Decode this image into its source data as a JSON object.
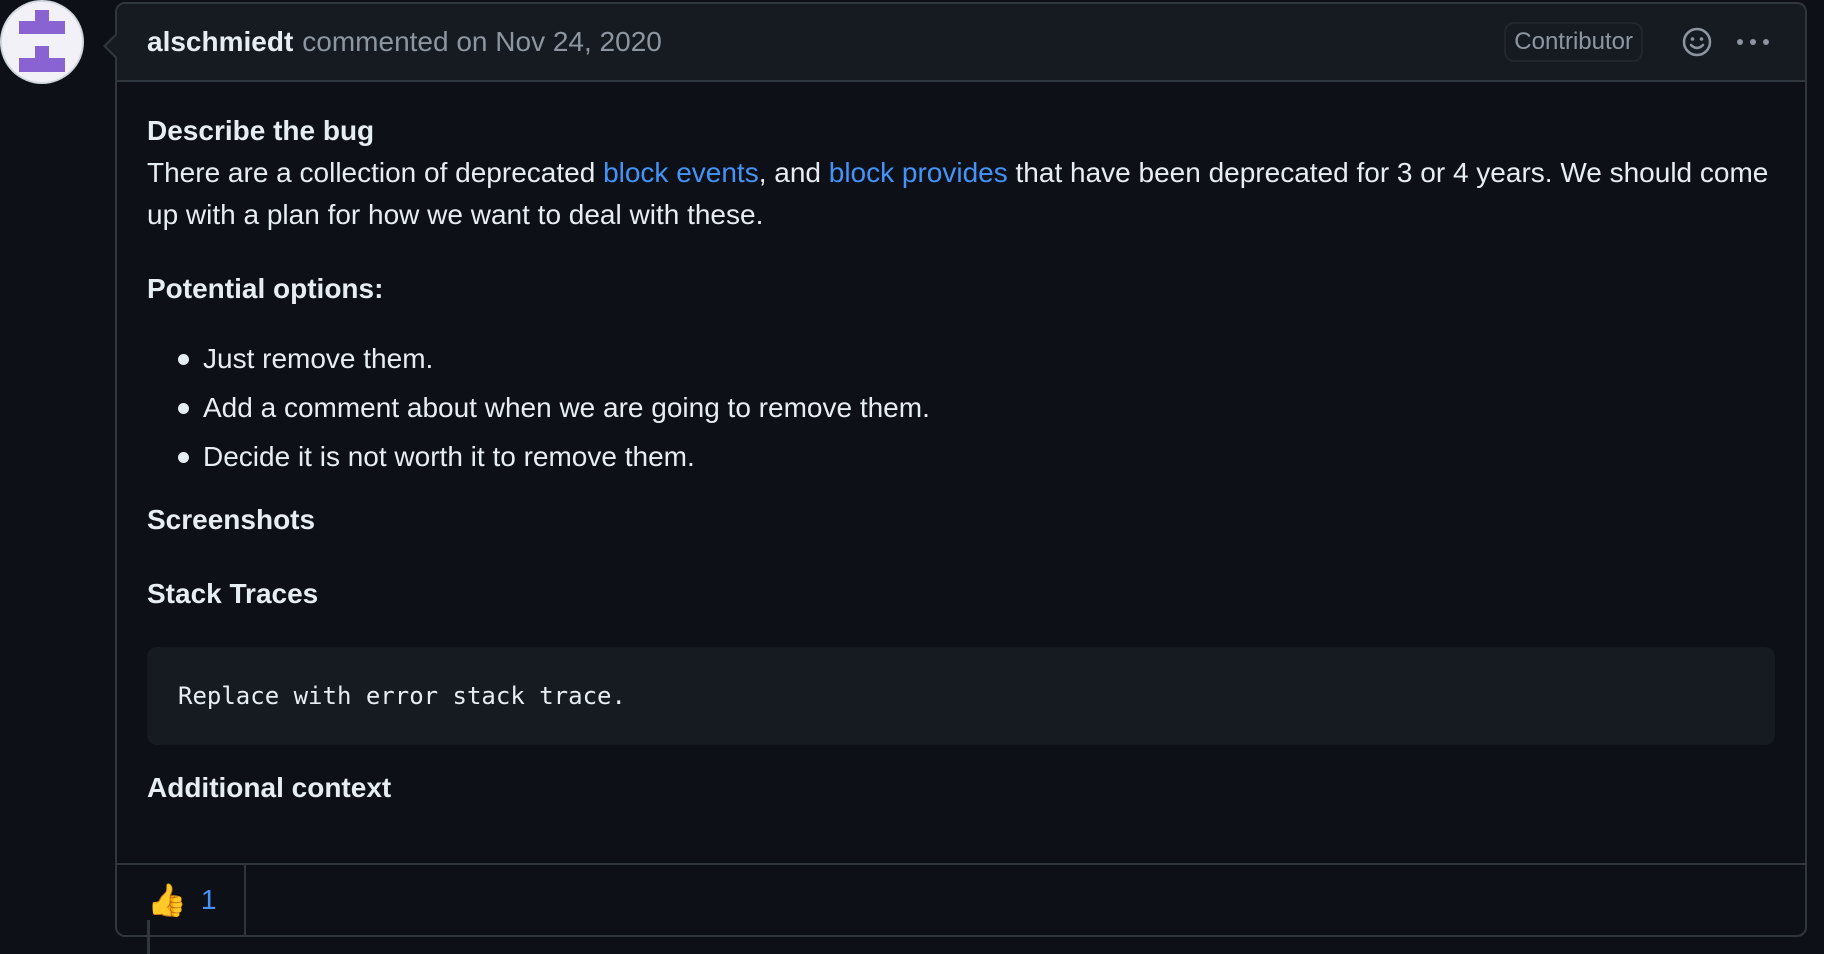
{
  "comment": {
    "author": "alschmiedt",
    "meta": "commented on Nov 24, 2020",
    "role_badge": "Contributor"
  },
  "body": {
    "heading_bug": "Describe the bug",
    "bug_text_1": "There are a collection of deprecated ",
    "link_block_events": "block events",
    "bug_text_2": ", and ",
    "link_block_provides": "block provides",
    "bug_text_3": " that have been deprecated for 3 or 4 years. We should come up with a plan for how we want to deal with these.",
    "heading_options": "Potential options:",
    "options": [
      "Just remove them.",
      "Add a comment about when we are going to remove them.",
      "Decide it is not worth it to remove them."
    ],
    "heading_screenshots": "Screenshots",
    "heading_stack": "Stack Traces",
    "code": "Replace with error stack trace.",
    "heading_context": "Additional context"
  },
  "reactions": [
    {
      "emoji": "👍",
      "count": "1"
    }
  ],
  "icons": {
    "avatar": "identicon-avatar",
    "reaction_add": "smiley-icon",
    "more": "kebab-horizontal-icon"
  },
  "colors": {
    "background": "#0d1117",
    "header_bg": "#161b22",
    "border": "#30363d",
    "link": "#4493f8",
    "muted": "#8d96a0",
    "avatar_purple": "#8a63d2"
  }
}
